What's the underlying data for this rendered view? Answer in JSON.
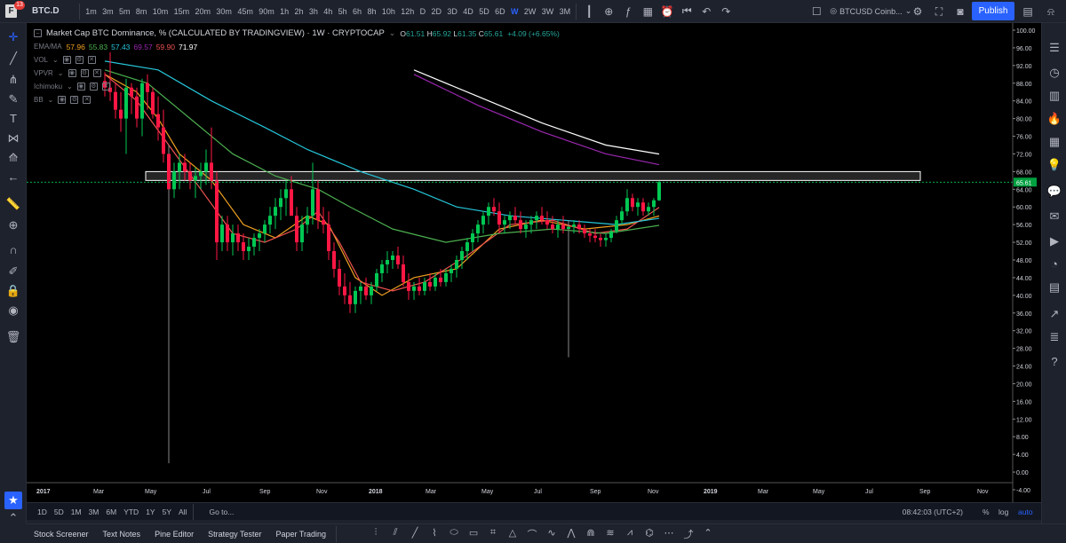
{
  "header": {
    "symbol": "BTC.D",
    "badge": "13",
    "timeframes": [
      "1m",
      "3m",
      "5m",
      "8m",
      "10m",
      "15m",
      "20m",
      "30m",
      "45m",
      "90m",
      "1h",
      "2h",
      "3h",
      "4h",
      "5h",
      "6h",
      "8h",
      "10h",
      "12h",
      "D",
      "2D",
      "3D",
      "4D",
      "5D",
      "6D",
      "W",
      "2W",
      "3W",
      "3M"
    ],
    "active_timeframe": "W",
    "compare_symbol": "BTCUSD Coinb...",
    "publish_label": "Publish"
  },
  "legend": {
    "title": "Market Cap BTC Dominance, % (CALCULATED BY TRADINGVIEW) · 1W · CRYPTOCAP",
    "ohlc": [
      {
        "label": "O",
        "value": "61.51"
      },
      {
        "label": "H",
        "value": "65.92"
      },
      {
        "label": "L",
        "value": "61.35"
      },
      {
        "label": "C",
        "value": "65.61"
      }
    ],
    "change": "+4.09 (+6.65%)",
    "ema_name": "EMA/MA",
    "ema_values": [
      {
        "value": "57.96",
        "color": "#f0a020"
      },
      {
        "value": "55.83",
        "color": "#4caf50"
      },
      {
        "value": "57.43",
        "color": "#26c6da"
      },
      {
        "value": "69.57",
        "color": "#9c27b0"
      },
      {
        "value": "59.90",
        "color": "#ef5350"
      },
      {
        "value": "71.97",
        "color": "#ffffff"
      }
    ],
    "indicators": [
      "VOL",
      "VPVR",
      "Ichimoku",
      "BB"
    ]
  },
  "chart_data": {
    "type": "candlestick",
    "price_axis": [
      "100.00",
      "96.00",
      "92.00",
      "88.00",
      "84.00",
      "80.00",
      "76.00",
      "72.00",
      "68.00",
      "64.00",
      "60.00",
      "56.00",
      "52.00",
      "48.00",
      "44.00",
      "40.00",
      "36.00",
      "32.00",
      "28.00",
      "24.00",
      "20.00",
      "16.00",
      "12.00",
      "8.00",
      "4.00",
      "0.00",
      "-4.00"
    ],
    "time_axis": [
      "2017",
      "Mar",
      "May",
      "Jul",
      "Sep",
      "Nov",
      "2018",
      "Mar",
      "May",
      "Jul",
      "Sep",
      "Nov",
      "2019",
      "Mar",
      "May",
      "Jul",
      "Sep",
      "Nov"
    ],
    "last_price_label": "65.61",
    "ylim": [
      -4,
      100
    ],
    "candles": [
      [
        88.5,
        90.5,
        85,
        87
      ],
      [
        87,
        95,
        84,
        86
      ],
      [
        86,
        88,
        80,
        82
      ],
      [
        82,
        86,
        77,
        80
      ],
      [
        80,
        89,
        72,
        87
      ],
      [
        87,
        88,
        81,
        85
      ],
      [
        85,
        87,
        78,
        80
      ],
      [
        80,
        89,
        76,
        88
      ],
      [
        88,
        90,
        82,
        86
      ],
      [
        86,
        87,
        80,
        81
      ],
      [
        81,
        85,
        75,
        78
      ],
      [
        78,
        82,
        70,
        72
      ],
      [
        72,
        74,
        2,
        64
      ],
      [
        64,
        70,
        62,
        68
      ],
      [
        68,
        72,
        64,
        70
      ],
      [
        70,
        72,
        66,
        68
      ],
      [
        68,
        70,
        64,
        66
      ],
      [
        66,
        69,
        62,
        67
      ],
      [
        67,
        70,
        64,
        68
      ],
      [
        68,
        73,
        65,
        70
      ],
      [
        70,
        78,
        64,
        66
      ],
      [
        66,
        68,
        48,
        52
      ],
      [
        52,
        58,
        50,
        56
      ],
      [
        56,
        58,
        50,
        52
      ],
      [
        52,
        56,
        49,
        54
      ],
      [
        54,
        56,
        50,
        52
      ],
      [
        52,
        54,
        48,
        50
      ],
      [
        50,
        53,
        48,
        51
      ],
      [
        51,
        54,
        49,
        53
      ],
      [
        53,
        55,
        50,
        54
      ],
      [
        54,
        57,
        52,
        56
      ],
      [
        56,
        60,
        54,
        58
      ],
      [
        58,
        62,
        55,
        60
      ],
      [
        60,
        64,
        57,
        62
      ],
      [
        62,
        66,
        58,
        64
      ],
      [
        64,
        67,
        60,
        58
      ],
      [
        58,
        60,
        50,
        52
      ],
      [
        52,
        58,
        50,
        56
      ],
      [
        56,
        60,
        54,
        58
      ],
      [
        58,
        70,
        56,
        64
      ],
      [
        64,
        66,
        55,
        57
      ],
      [
        57,
        60,
        54,
        56
      ],
      [
        56,
        59,
        48,
        50
      ],
      [
        50,
        52,
        44,
        46
      ],
      [
        46,
        48,
        40,
        42
      ],
      [
        42,
        45,
        38,
        40
      ],
      [
        40,
        43,
        36,
        38
      ],
      [
        38,
        42,
        36,
        41
      ],
      [
        41,
        43,
        38,
        42
      ],
      [
        42,
        44,
        39,
        40
      ],
      [
        40,
        43,
        38,
        42
      ],
      [
        42,
        46,
        41,
        45
      ],
      [
        45,
        48,
        43,
        47
      ],
      [
        47,
        50,
        45,
        48
      ],
      [
        48,
        50,
        46,
        49
      ],
      [
        49,
        51,
        46,
        47
      ],
      [
        47,
        49,
        42,
        43
      ],
      [
        43,
        45,
        39,
        41
      ],
      [
        41,
        43,
        39,
        42
      ],
      [
        42,
        44,
        40,
        41
      ],
      [
        41,
        44,
        40,
        43
      ],
      [
        43,
        45,
        41,
        42
      ],
      [
        42,
        45,
        41,
        44
      ],
      [
        44,
        46,
        42,
        43
      ],
      [
        43,
        46,
        42,
        45
      ],
      [
        45,
        47,
        43,
        46
      ],
      [
        46,
        49,
        44,
        48
      ],
      [
        48,
        51,
        46,
        50
      ],
      [
        50,
        53,
        48,
        52
      ],
      [
        52,
        55,
        50,
        54
      ],
      [
        54,
        57,
        52,
        56
      ],
      [
        56,
        59,
        54,
        58
      ],
      [
        58,
        61,
        56,
        60
      ],
      [
        60,
        62,
        58,
        59
      ],
      [
        59,
        61,
        54,
        56
      ],
      [
        56,
        58,
        54,
        57
      ],
      [
        57,
        59,
        55,
        58
      ],
      [
        58,
        60,
        56,
        57
      ],
      [
        57,
        59,
        54,
        55
      ],
      [
        55,
        57,
        53,
        56
      ],
      [
        56,
        58,
        54,
        57
      ],
      [
        57,
        59,
        55,
        58
      ],
      [
        58,
        60,
        56,
        57
      ],
      [
        57,
        59,
        55,
        56
      ],
      [
        56,
        58,
        54,
        55
      ],
      [
        55,
        57,
        53,
        56
      ],
      [
        56,
        58,
        54,
        55
      ],
      [
        55,
        57,
        26,
        55.5
      ],
      [
        55.5,
        57,
        54,
        56
      ],
      [
        56,
        57,
        54,
        55
      ],
      [
        55,
        56,
        53,
        54
      ],
      [
        54,
        55,
        52,
        53.5
      ],
      [
        53.5,
        55,
        52,
        53
      ],
      [
        53,
        54,
        51,
        52.5
      ],
      [
        52.5,
        54,
        51,
        53
      ],
      [
        53,
        55,
        52,
        54.5
      ],
      [
        54.5,
        58,
        54,
        57
      ],
      [
        57,
        60,
        56,
        59
      ],
      [
        59,
        64,
        58,
        62
      ],
      [
        62,
        63,
        59,
        60
      ],
      [
        60,
        62,
        58,
        61
      ],
      [
        61,
        62,
        58,
        59
      ],
      [
        59,
        61,
        58,
        60
      ],
      [
        60,
        62,
        58,
        61.5
      ],
      [
        61.51,
        65.92,
        61.35,
        65.61
      ]
    ],
    "ema_series": [
      {
        "color": "#f0a020",
        "points": [
          [
            0,
            90
          ],
          [
            6,
            86
          ],
          [
            10,
            80
          ],
          [
            14,
            72
          ],
          [
            20,
            66
          ],
          [
            26,
            56
          ],
          [
            32,
            53
          ],
          [
            38,
            58
          ],
          [
            42,
            56
          ],
          [
            47,
            44
          ],
          [
            52,
            40
          ],
          [
            58,
            44
          ],
          [
            66,
            46
          ],
          [
            74,
            55
          ],
          [
            82,
            57
          ],
          [
            90,
            55
          ],
          [
            98,
            56
          ],
          [
            104,
            57.96
          ]
        ]
      },
      {
        "color": "#ef5350",
        "points": [
          [
            0,
            90
          ],
          [
            6,
            84
          ],
          [
            12,
            74
          ],
          [
            18,
            64
          ],
          [
            24,
            54
          ],
          [
            30,
            52
          ],
          [
            36,
            55
          ],
          [
            40,
            59
          ],
          [
            44,
            52
          ],
          [
            48,
            43
          ],
          [
            54,
            41
          ],
          [
            60,
            43
          ],
          [
            68,
            49
          ],
          [
            76,
            56
          ],
          [
            84,
            57
          ],
          [
            92,
            54
          ],
          [
            98,
            55
          ],
          [
            104,
            59.9
          ]
        ]
      },
      {
        "color": "#4caf50",
        "points": [
          [
            0,
            91
          ],
          [
            8,
            88
          ],
          [
            16,
            80
          ],
          [
            24,
            72
          ],
          [
            32,
            67
          ],
          [
            40,
            64
          ],
          [
            46,
            60
          ],
          [
            54,
            55
          ],
          [
            64,
            52
          ],
          [
            74,
            54
          ],
          [
            84,
            55
          ],
          [
            94,
            54
          ],
          [
            104,
            55.83
          ]
        ]
      },
      {
        "color": "#26c6da",
        "points": [
          [
            0,
            93
          ],
          [
            10,
            91
          ],
          [
            20,
            84
          ],
          [
            30,
            78
          ],
          [
            38,
            73
          ],
          [
            48,
            68
          ],
          [
            58,
            64
          ],
          [
            66,
            60
          ],
          [
            76,
            58
          ],
          [
            86,
            57
          ],
          [
            96,
            56
          ],
          [
            104,
            57.43
          ]
        ]
      },
      {
        "color": "#9c27b0",
        "points": [
          [
            58,
            90
          ],
          [
            70,
            83
          ],
          [
            82,
            77
          ],
          [
            94,
            72
          ],
          [
            104,
            69.57
          ]
        ]
      },
      {
        "color": "#ffffff",
        "points": [
          [
            58,
            91
          ],
          [
            70,
            85
          ],
          [
            82,
            79
          ],
          [
            94,
            74
          ],
          [
            104,
            71.97
          ]
        ]
      }
    ],
    "zone": {
      "y_low": 66,
      "y_high": 68
    },
    "zone_color": "#ffffff",
    "up_color": "#00c853",
    "down_color": "#ff1744"
  },
  "bottom": {
    "ranges": [
      "1D",
      "5D",
      "1M",
      "3M",
      "6M",
      "YTD",
      "1Y",
      "5Y",
      "All"
    ],
    "goto": "Go to...",
    "clock": "08:42:03 (UTC+2)",
    "scale_percent": "%",
    "scale_log": "log",
    "scale_auto": "auto",
    "tabs": [
      "Stock Screener",
      "Text Notes",
      "Pine Editor",
      "Strategy Tester",
      "Paper Trading"
    ]
  }
}
